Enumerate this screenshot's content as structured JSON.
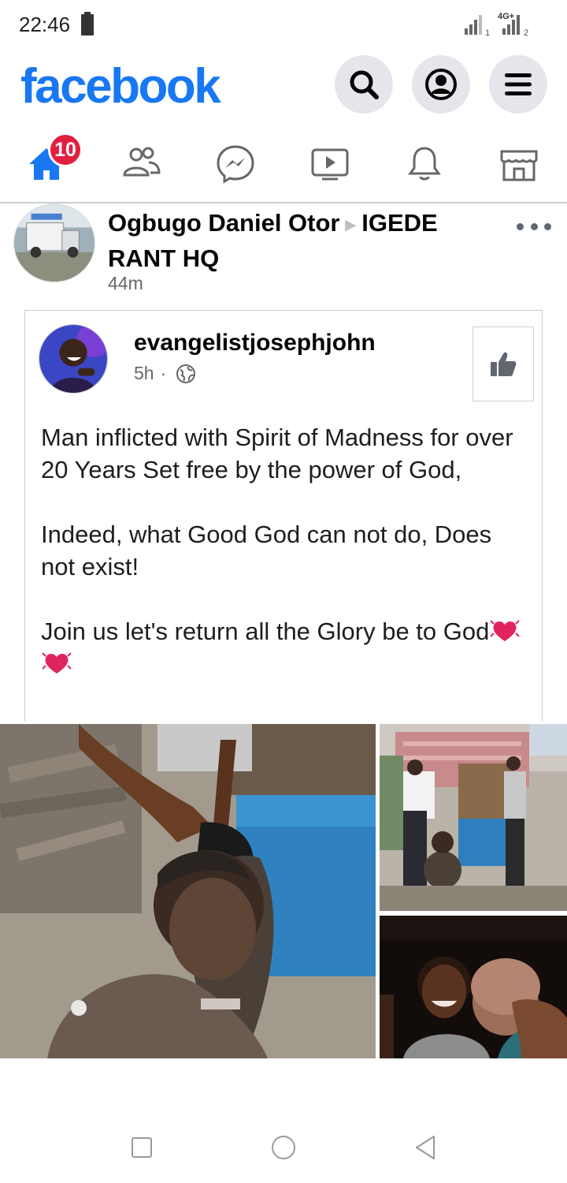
{
  "status_bar": {
    "time": "22:46",
    "network_label": "4G+",
    "sim1": "1",
    "sim2": "2"
  },
  "header": {
    "logo_text": "facebook",
    "buttons": [
      "search-icon",
      "profile-icon",
      "menu-icon"
    ]
  },
  "nav": {
    "tabs": [
      "home-icon",
      "friends-icon",
      "messenger-icon",
      "watch-icon",
      "notifications-icon",
      "marketplace-icon"
    ],
    "home_badge": "10",
    "active_color": "#1877f2"
  },
  "post": {
    "author": "Ogbugo Daniel Otor",
    "group": "IGEDE RANT HQ",
    "time": "44m"
  },
  "shared_post": {
    "author": "evangelistjosephjohn",
    "time": "5h",
    "separator": "·",
    "paragraphs": [
      "Man inflicted with Spirit of Madness for over 20 Years Set free by the power of God,",
      "Indeed, what Good God can not do, Does not exist!",
      "Join us let's return all the Glory be to God"
    ]
  },
  "colors": {
    "brand": "#1877f2",
    "badge": "#e41e3f",
    "secondary_text": "#65676b"
  }
}
